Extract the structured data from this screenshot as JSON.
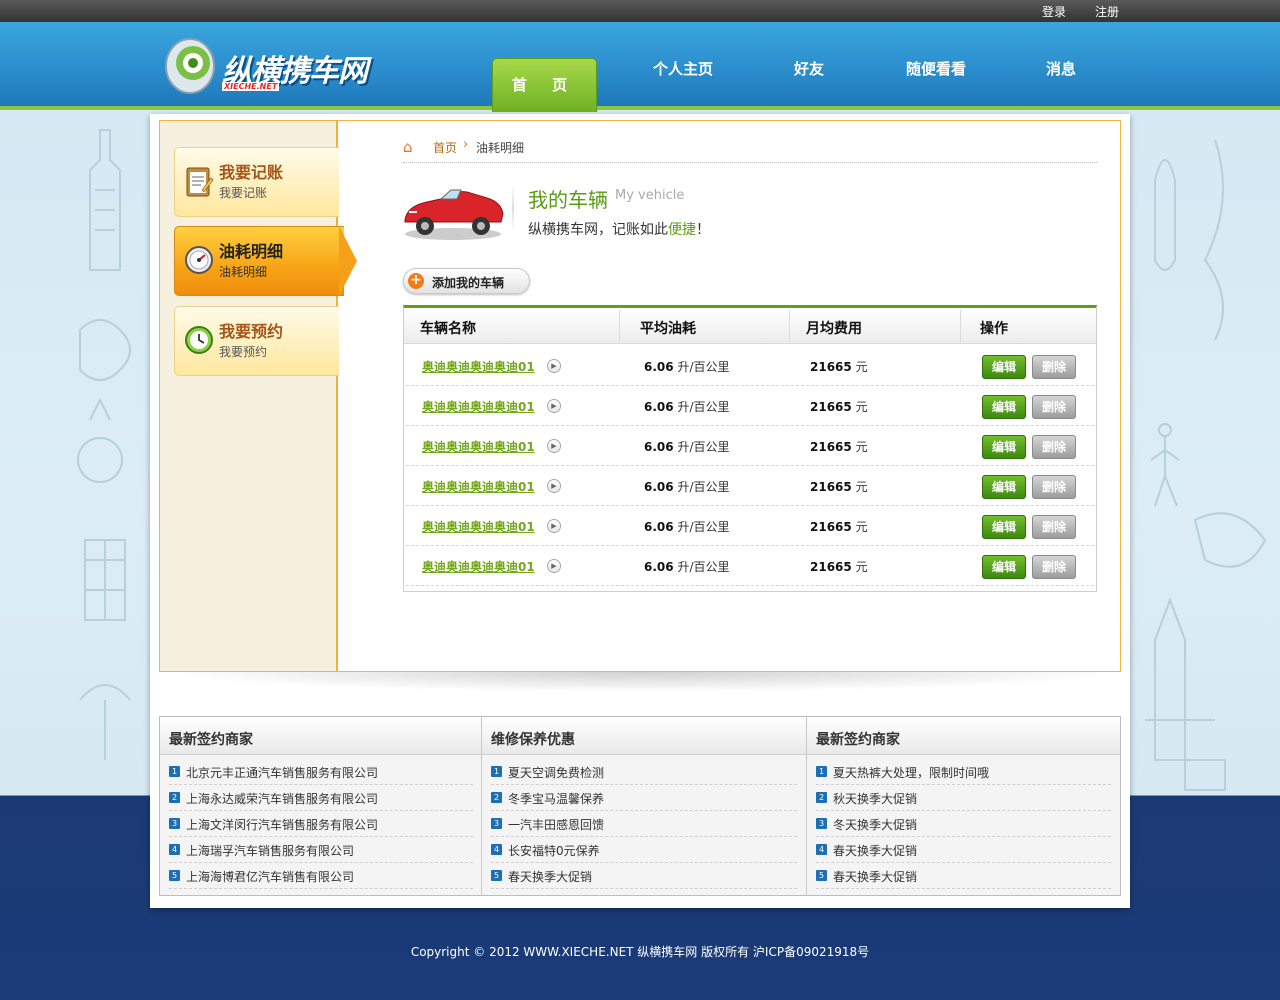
{
  "topbar": {
    "login": "登录",
    "register": "注册"
  },
  "logo": {
    "text": "纵横携车网",
    "sub": "XIECHE.NET"
  },
  "nav": {
    "home": "首 页",
    "items": [
      "个人主页",
      "好友",
      "随便看看",
      "消息"
    ]
  },
  "sidebar": {
    "items": [
      {
        "title": "我要记账",
        "sub": "我要记账",
        "icon": "notepad-icon"
      },
      {
        "title": "油耗明细",
        "sub": "油耗明细",
        "icon": "gauge-icon"
      },
      {
        "title": "我要预约",
        "sub": "我要预约",
        "icon": "clock-icon"
      }
    ]
  },
  "breadcrumb": {
    "home": "首页",
    "current": "油耗明细"
  },
  "vehicle": {
    "title": "我的车辆",
    "subtitle": "My vehicle",
    "slogan_prefix": "纵横携车网，记账如此",
    "slogan_highlight": "便捷",
    "slogan_suffix": "！"
  },
  "add_button": "添加我的车辆",
  "table": {
    "headers": [
      "车辆名称",
      "平均油耗",
      "月均费用",
      "操作"
    ],
    "rows": [
      {
        "name": "奥迪奥迪奥迪奥迪01",
        "fuel": "6.06",
        "fuel_unit": "升/百公里",
        "cost": "21665",
        "cost_unit": "元"
      },
      {
        "name": "奥迪奥迪奥迪奥迪01",
        "fuel": "6.06",
        "fuel_unit": "升/百公里",
        "cost": "21665",
        "cost_unit": "元"
      },
      {
        "name": "奥迪奥迪奥迪奥迪01",
        "fuel": "6.06",
        "fuel_unit": "升/百公里",
        "cost": "21665",
        "cost_unit": "元"
      },
      {
        "name": "奥迪奥迪奥迪奥迪01",
        "fuel": "6.06",
        "fuel_unit": "升/百公里",
        "cost": "21665",
        "cost_unit": "元"
      },
      {
        "name": "奥迪奥迪奥迪奥迪01",
        "fuel": "6.06",
        "fuel_unit": "升/百公里",
        "cost": "21665",
        "cost_unit": "元"
      },
      {
        "name": "奥迪奥迪奥迪奥迪01",
        "fuel": "6.06",
        "fuel_unit": "升/百公里",
        "cost": "21665",
        "cost_unit": "元"
      }
    ],
    "edit_label": "编辑",
    "delete_label": "删除"
  },
  "bottom": {
    "columns": [
      {
        "title": "最新签约商家",
        "items": [
          "北京元丰正通汽车销售服务有限公司",
          "上海永达威荣汽车销售服务有限公司",
          "上海文洋闵行汽车销售服务有限公司",
          "上海瑞孚汽车销售服务有限公司",
          "上海海博君亿汽车销售有限公司"
        ]
      },
      {
        "title": "维修保养优惠",
        "items": [
          "夏天空调免费检测",
          "冬季宝马温馨保养",
          "一汽丰田感恩回馈",
          "长安福特0元保养",
          "春天换季大促销"
        ]
      },
      {
        "title": "最新签约商家",
        "items": [
          "夏天热裤大处理，限制时间哦",
          "秋天换季大促销",
          "冬天换季大促销",
          "春天换季大促销",
          "春天换季大促销"
        ]
      }
    ]
  },
  "footer": "Copyright © 2012 WWW.XIECHE.NET  纵横携车网 版权所有    沪ICP备09021918号",
  "colors": {
    "accent_green": "#5a9c16",
    "header_blue": "#2a8ccc",
    "sidebar_orange": "#f7a416",
    "footer_navy": "#1a3a78"
  }
}
